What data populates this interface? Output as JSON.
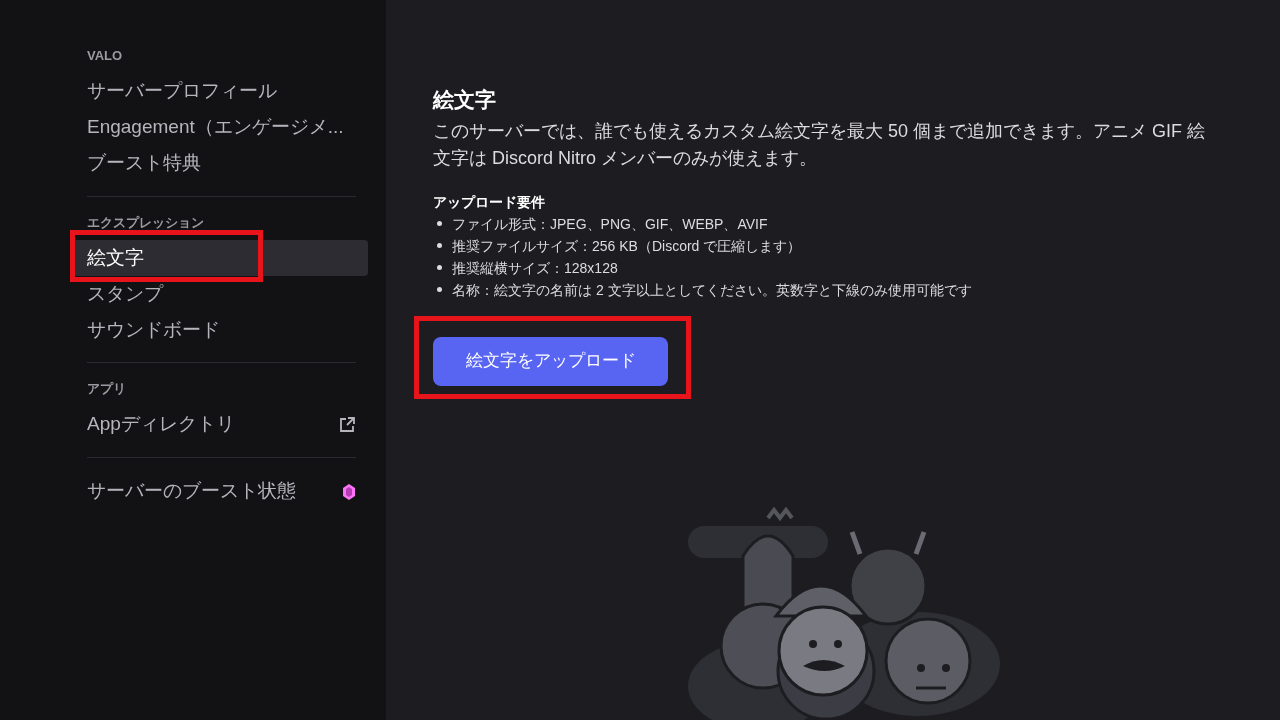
{
  "sidebar": {
    "sections": [
      {
        "header": "VALO",
        "items": [
          {
            "label": "サーバープロフィール",
            "kind": "page",
            "selected": false
          },
          {
            "label": "Engagement（エンゲージメ...",
            "kind": "page",
            "selected": false
          },
          {
            "label": "ブースト特典",
            "kind": "page",
            "selected": false
          }
        ]
      },
      {
        "header": "エクスプレッション",
        "items": [
          {
            "label": "絵文字",
            "kind": "page",
            "selected": true
          },
          {
            "label": "スタンプ",
            "kind": "page",
            "selected": false
          },
          {
            "label": "サウンドボード",
            "kind": "page",
            "selected": false
          }
        ]
      },
      {
        "header": "アプリ",
        "items": [
          {
            "label": "Appディレクトリ",
            "kind": "external",
            "selected": false
          }
        ]
      },
      {
        "items": [
          {
            "label": "サーバーのブースト状態",
            "kind": "boost",
            "selected": false
          }
        ]
      }
    ]
  },
  "main": {
    "title": "絵文字",
    "description": "このサーバーでは、誰でも使えるカスタム絵文字を最大 50 個まで追加できます。アニメ GIF 絵文字は Discord Nitro メンバーのみが使えます。",
    "requirements_heading": "アップロード要件",
    "requirements": [
      "ファイル形式：JPEG、PNG、GIF、WEBP、AVIF",
      "推奨ファイルサイズ：256 KB（Discord で圧縮します）",
      "推奨縦横サイズ：128x128",
      "名称：絵文字の名前は 2 文字以上としてください。英数字と下線のみ使用可能です"
    ],
    "upload_button": "絵文字をアップロード"
  }
}
